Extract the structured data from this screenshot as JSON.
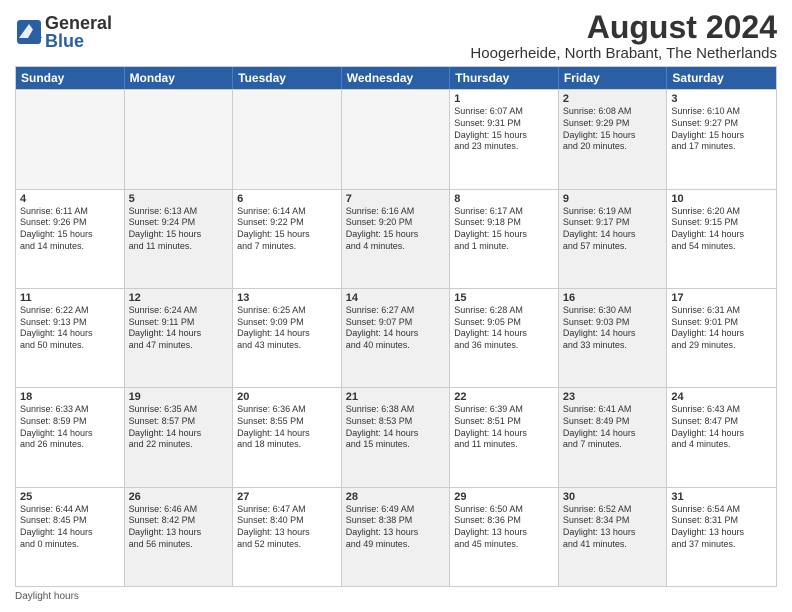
{
  "logo": {
    "general": "General",
    "blue": "Blue"
  },
  "title": "August 2024",
  "subtitle": "Hoogerheide, North Brabant, The Netherlands",
  "weekdays": [
    "Sunday",
    "Monday",
    "Tuesday",
    "Wednesday",
    "Thursday",
    "Friday",
    "Saturday"
  ],
  "footer": "Daylight hours",
  "weeks": [
    [
      {
        "day": "",
        "info": "",
        "empty": true
      },
      {
        "day": "",
        "info": "",
        "empty": true
      },
      {
        "day": "",
        "info": "",
        "empty": true
      },
      {
        "day": "",
        "info": "",
        "empty": true
      },
      {
        "day": "1",
        "info": "Sunrise: 6:07 AM\nSunset: 9:31 PM\nDaylight: 15 hours\nand 23 minutes."
      },
      {
        "day": "2",
        "info": "Sunrise: 6:08 AM\nSunset: 9:29 PM\nDaylight: 15 hours\nand 20 minutes.",
        "shaded": true
      },
      {
        "day": "3",
        "info": "Sunrise: 6:10 AM\nSunset: 9:27 PM\nDaylight: 15 hours\nand 17 minutes."
      }
    ],
    [
      {
        "day": "4",
        "info": "Sunrise: 6:11 AM\nSunset: 9:26 PM\nDaylight: 15 hours\nand 14 minutes."
      },
      {
        "day": "5",
        "info": "Sunrise: 6:13 AM\nSunset: 9:24 PM\nDaylight: 15 hours\nand 11 minutes.",
        "shaded": true
      },
      {
        "day": "6",
        "info": "Sunrise: 6:14 AM\nSunset: 9:22 PM\nDaylight: 15 hours\nand 7 minutes."
      },
      {
        "day": "7",
        "info": "Sunrise: 6:16 AM\nSunset: 9:20 PM\nDaylight: 15 hours\nand 4 minutes.",
        "shaded": true
      },
      {
        "day": "8",
        "info": "Sunrise: 6:17 AM\nSunset: 9:18 PM\nDaylight: 15 hours\nand 1 minute."
      },
      {
        "day": "9",
        "info": "Sunrise: 6:19 AM\nSunset: 9:17 PM\nDaylight: 14 hours\nand 57 minutes.",
        "shaded": true
      },
      {
        "day": "10",
        "info": "Sunrise: 6:20 AM\nSunset: 9:15 PM\nDaylight: 14 hours\nand 54 minutes."
      }
    ],
    [
      {
        "day": "11",
        "info": "Sunrise: 6:22 AM\nSunset: 9:13 PM\nDaylight: 14 hours\nand 50 minutes."
      },
      {
        "day": "12",
        "info": "Sunrise: 6:24 AM\nSunset: 9:11 PM\nDaylight: 14 hours\nand 47 minutes.",
        "shaded": true
      },
      {
        "day": "13",
        "info": "Sunrise: 6:25 AM\nSunset: 9:09 PM\nDaylight: 14 hours\nand 43 minutes."
      },
      {
        "day": "14",
        "info": "Sunrise: 6:27 AM\nSunset: 9:07 PM\nDaylight: 14 hours\nand 40 minutes.",
        "shaded": true
      },
      {
        "day": "15",
        "info": "Sunrise: 6:28 AM\nSunset: 9:05 PM\nDaylight: 14 hours\nand 36 minutes."
      },
      {
        "day": "16",
        "info": "Sunrise: 6:30 AM\nSunset: 9:03 PM\nDaylight: 14 hours\nand 33 minutes.",
        "shaded": true
      },
      {
        "day": "17",
        "info": "Sunrise: 6:31 AM\nSunset: 9:01 PM\nDaylight: 14 hours\nand 29 minutes."
      }
    ],
    [
      {
        "day": "18",
        "info": "Sunrise: 6:33 AM\nSunset: 8:59 PM\nDaylight: 14 hours\nand 26 minutes."
      },
      {
        "day": "19",
        "info": "Sunrise: 6:35 AM\nSunset: 8:57 PM\nDaylight: 14 hours\nand 22 minutes.",
        "shaded": true
      },
      {
        "day": "20",
        "info": "Sunrise: 6:36 AM\nSunset: 8:55 PM\nDaylight: 14 hours\nand 18 minutes."
      },
      {
        "day": "21",
        "info": "Sunrise: 6:38 AM\nSunset: 8:53 PM\nDaylight: 14 hours\nand 15 minutes.",
        "shaded": true
      },
      {
        "day": "22",
        "info": "Sunrise: 6:39 AM\nSunset: 8:51 PM\nDaylight: 14 hours\nand 11 minutes."
      },
      {
        "day": "23",
        "info": "Sunrise: 6:41 AM\nSunset: 8:49 PM\nDaylight: 14 hours\nand 7 minutes.",
        "shaded": true
      },
      {
        "day": "24",
        "info": "Sunrise: 6:43 AM\nSunset: 8:47 PM\nDaylight: 14 hours\nand 4 minutes."
      }
    ],
    [
      {
        "day": "25",
        "info": "Sunrise: 6:44 AM\nSunset: 8:45 PM\nDaylight: 14 hours\nand 0 minutes."
      },
      {
        "day": "26",
        "info": "Sunrise: 6:46 AM\nSunset: 8:42 PM\nDaylight: 13 hours\nand 56 minutes.",
        "shaded": true
      },
      {
        "day": "27",
        "info": "Sunrise: 6:47 AM\nSunset: 8:40 PM\nDaylight: 13 hours\nand 52 minutes."
      },
      {
        "day": "28",
        "info": "Sunrise: 6:49 AM\nSunset: 8:38 PM\nDaylight: 13 hours\nand 49 minutes.",
        "shaded": true
      },
      {
        "day": "29",
        "info": "Sunrise: 6:50 AM\nSunset: 8:36 PM\nDaylight: 13 hours\nand 45 minutes."
      },
      {
        "day": "30",
        "info": "Sunrise: 6:52 AM\nSunset: 8:34 PM\nDaylight: 13 hours\nand 41 minutes.",
        "shaded": true
      },
      {
        "day": "31",
        "info": "Sunrise: 6:54 AM\nSunset: 8:31 PM\nDaylight: 13 hours\nand 37 minutes."
      }
    ]
  ]
}
